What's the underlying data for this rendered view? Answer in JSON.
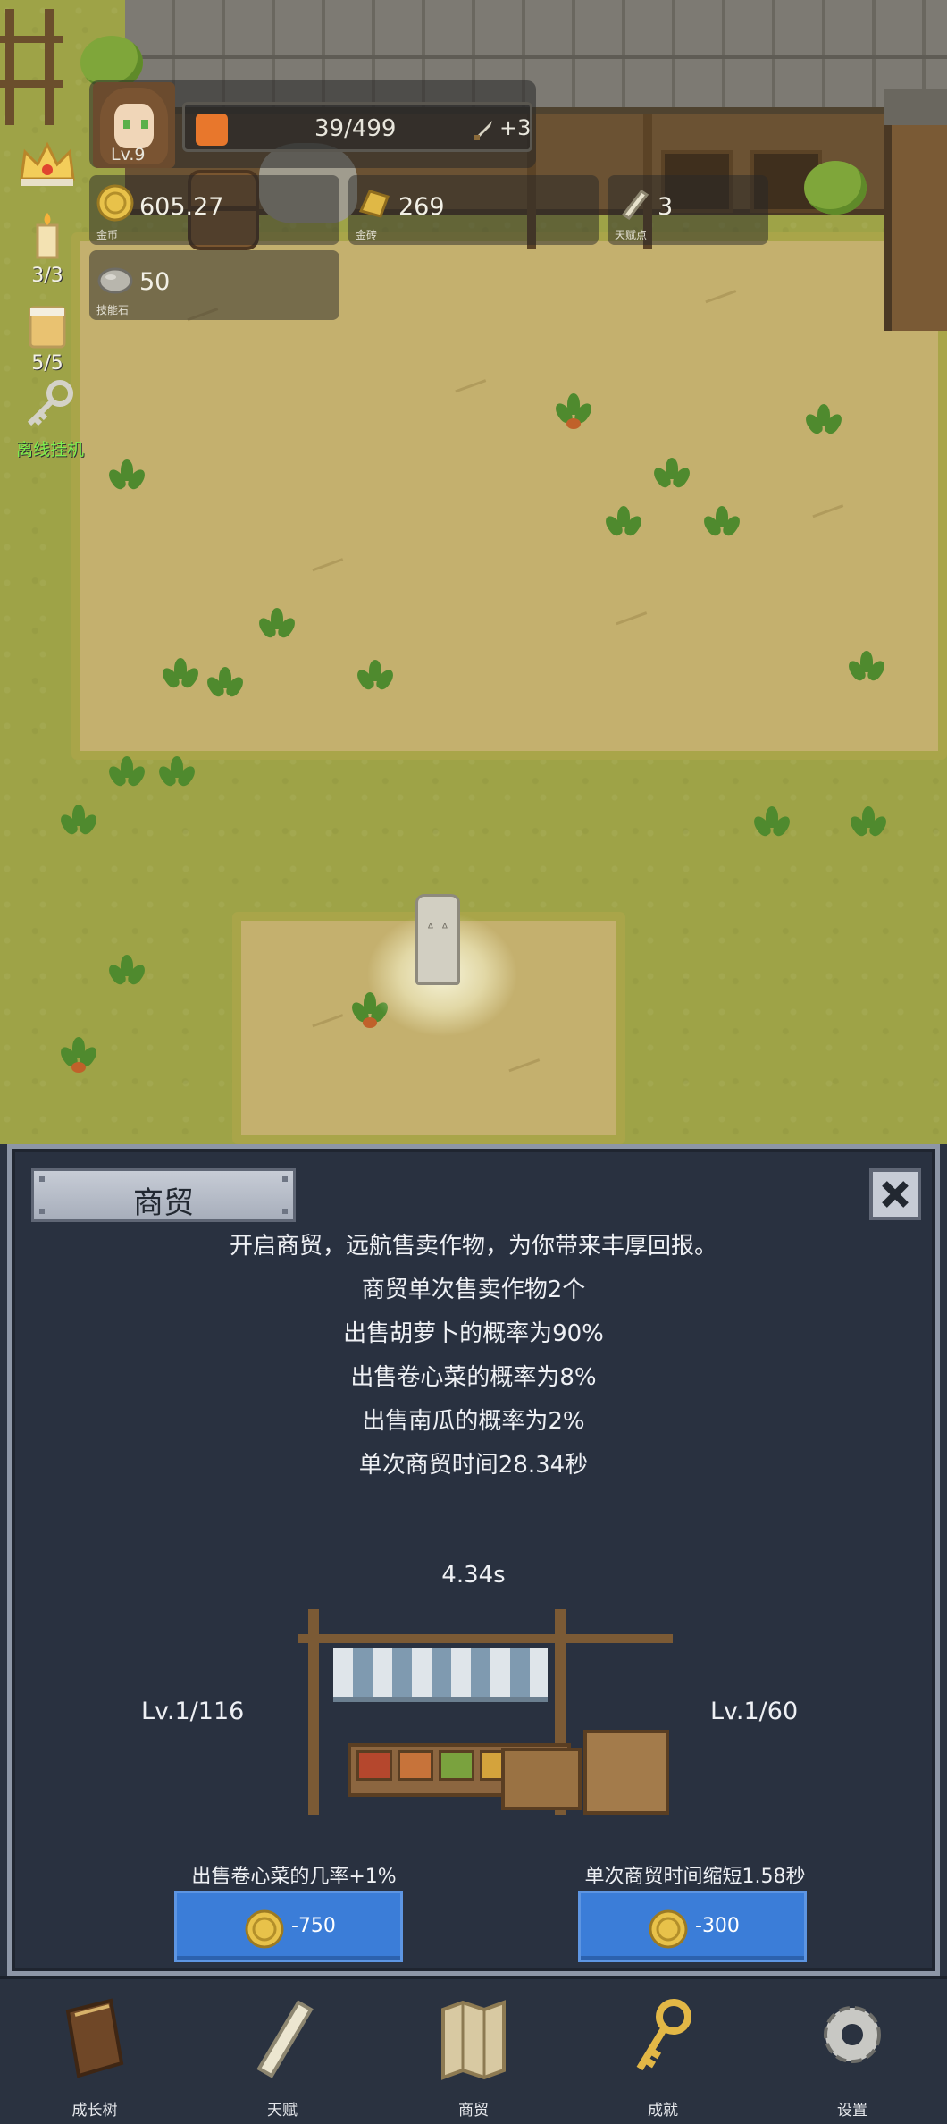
{
  "hud": {
    "level": "Lv.9",
    "exp": "39/499",
    "exp_bonus": "+3",
    "gold": {
      "value": "605.27",
      "label": "金币"
    },
    "gold_bar": {
      "value": "269",
      "label": "金砖"
    },
    "talent_points": {
      "value": "3",
      "label": "天赋点"
    },
    "skill_stone": {
      "value": "50",
      "label": "技能石"
    }
  },
  "side": {
    "candle_count": "3/3",
    "drink_count": "5/5",
    "idle_label": "离线挂机"
  },
  "panel": {
    "title": "商贸",
    "lines": [
      "开启商贸，远航售卖作物，为你带来丰厚回报。",
      "商贸单次售卖作物2个",
      "出售胡萝卜的概率为90%",
      "出售卷心菜的概率为8%",
      "出售南瓜的概率为2%",
      "单次商贸时间28.34秒"
    ],
    "timer": "4.34s",
    "left_level": "Lv.1/116",
    "right_level": "Lv.1/60",
    "left_upgrade_label": "出售卷心菜的几率+1%",
    "right_upgrade_label": "单次商贸时间缩短1.58秒",
    "left_cost": "-750",
    "right_cost": "-300"
  },
  "nav": [
    {
      "label": "成长树",
      "icon": "book-icon"
    },
    {
      "label": "天赋",
      "icon": "scroll-icon"
    },
    {
      "label": "商贸",
      "icon": "map-icon"
    },
    {
      "label": "成就",
      "icon": "key-icon"
    },
    {
      "label": "设置",
      "icon": "gear-icon"
    }
  ],
  "colors": {
    "panel_bg": "#293140",
    "button_blue": "#3b7dd8",
    "grass": "#9ea347",
    "dirt": "#c4b06e"
  }
}
